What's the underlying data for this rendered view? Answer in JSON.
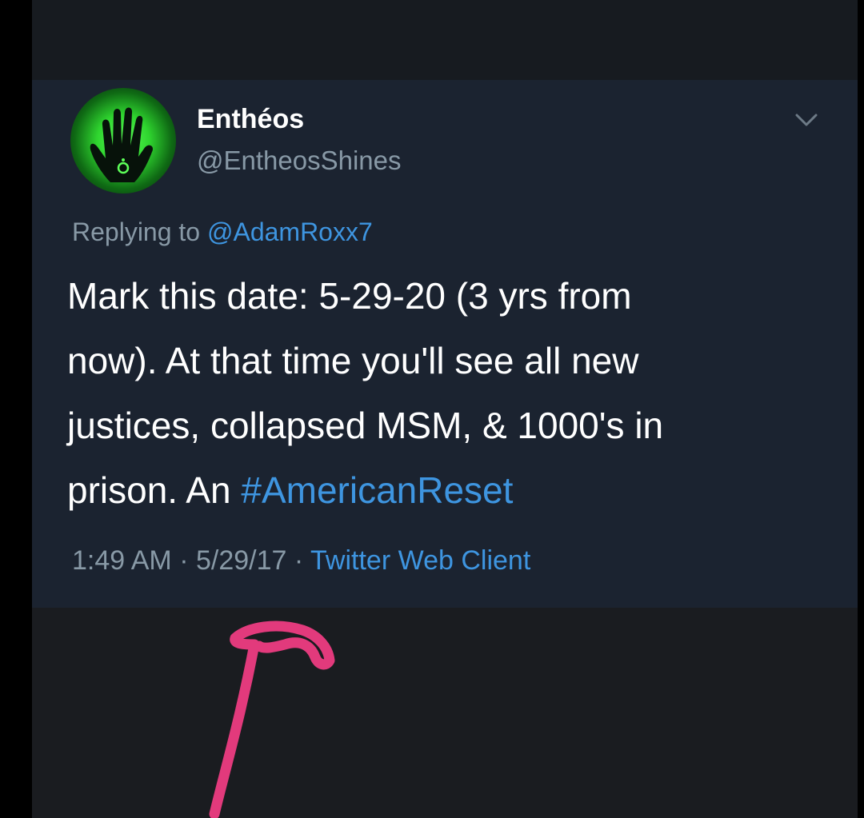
{
  "tweet": {
    "display_name": "Enthéos",
    "handle": "@EntheosShines",
    "avatar_icon": "green-hand-icon",
    "reply_prefix": "Replying to ",
    "reply_handle": "@AdamRoxx7",
    "text_lines": [
      "Mark this date:  5-29-20 (3 yrs from",
      "now).  At that time you'll see all new",
      "justices, collapsed MSM, & 1000's in"
    ],
    "text_last_line_prefix": "prison.  An ",
    "hashtag": "#AmericanReset",
    "time": "1:49 AM",
    "separator": " · ",
    "date": "5/29/17",
    "source": "Twitter Web Client"
  },
  "colors": {
    "background": "#15191f",
    "card": "#1b2330",
    "link": "#3e95e0",
    "muted": "#8899a6",
    "annotation_arrow": "#e23a7c"
  },
  "annotation": {
    "type": "hand-drawn-arrow",
    "icon": "pink-arrow-icon"
  }
}
